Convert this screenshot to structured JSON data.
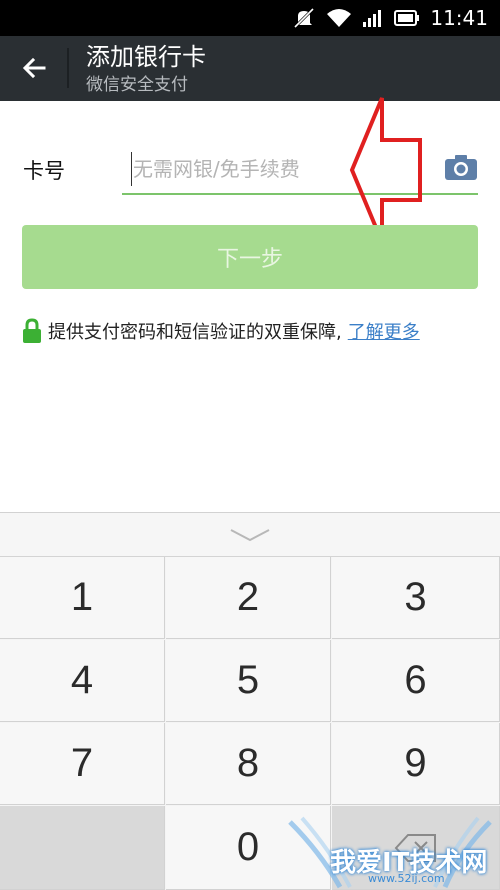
{
  "status_bar": {
    "time": "11:41"
  },
  "header": {
    "title": "添加银行卡",
    "subtitle": "微信安全支付"
  },
  "form": {
    "card_label": "卡号",
    "card_placeholder": "无需网银/免手续费",
    "next_label": "下一步",
    "secure_text": "提供支付密码和短信验证的双重保障,",
    "learn_more": "了解更多"
  },
  "keypad": {
    "keys": [
      "1",
      "2",
      "3",
      "4",
      "5",
      "6",
      "7",
      "8",
      "9",
      "",
      "0",
      ""
    ]
  },
  "watermark": {
    "text": "我爱IT技术网",
    "url": "www.52ij.com"
  },
  "colors": {
    "accent": "#7cc46b",
    "button": "#a6db8f",
    "link": "#3b7fc8",
    "titlebar": "#2a2f33",
    "arrow": "#e02020"
  }
}
